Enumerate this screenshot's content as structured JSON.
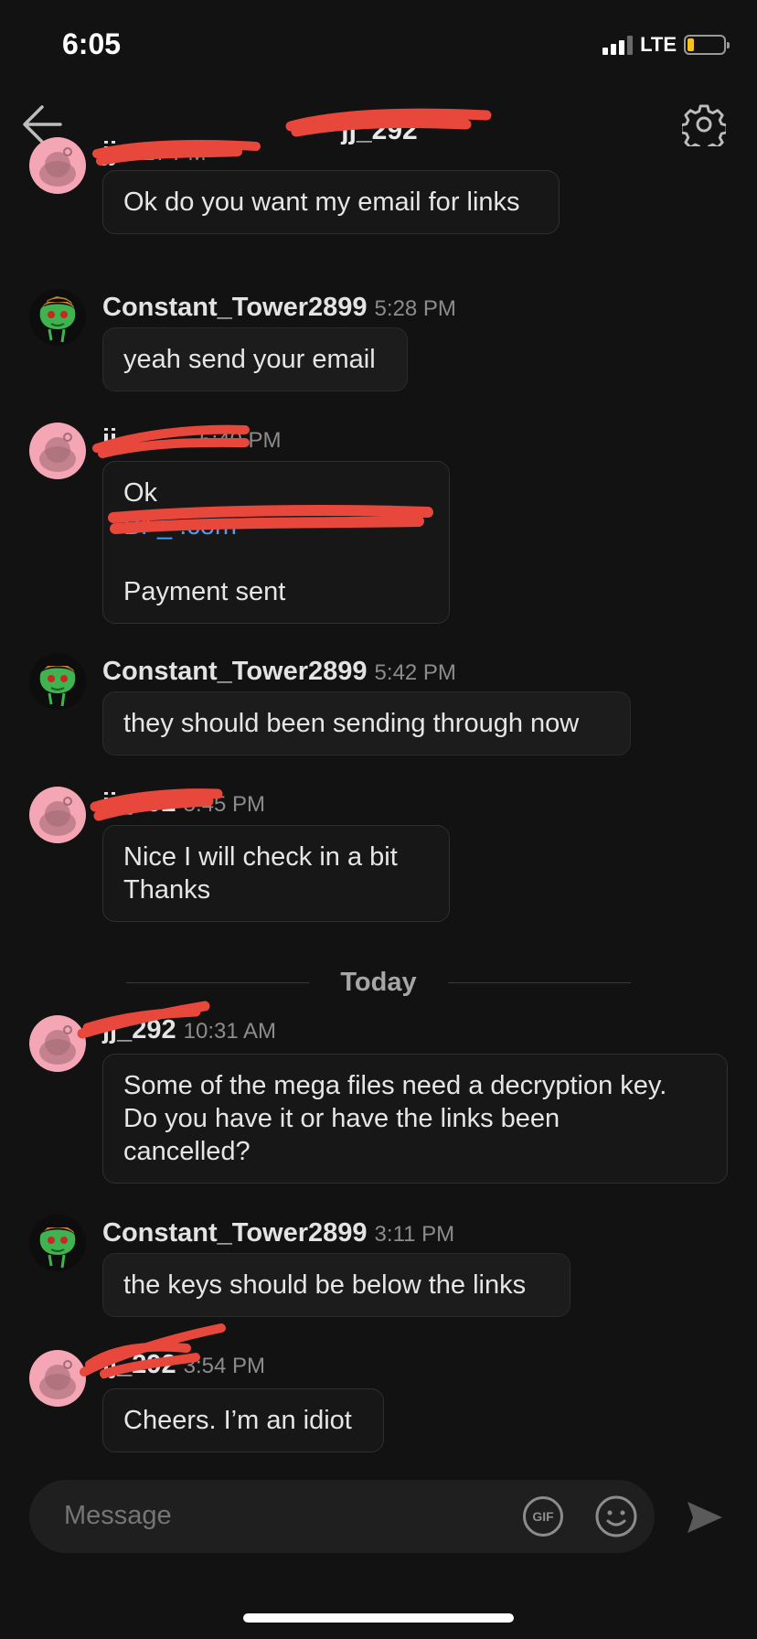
{
  "status_bar": {
    "time": "6:05",
    "network": "LTE",
    "battery_level": 0.18
  },
  "header": {
    "title": "jj_292",
    "back_icon": "back-arrow-icon",
    "settings_icon": "gear-icon"
  },
  "messages": [
    {
      "user": "jj",
      "time": "5:27 PM",
      "own": true,
      "lines": [
        "Ok do you want my email for links"
      ]
    },
    {
      "user": "Constant_Tower2899",
      "time": "5:28 PM",
      "own": false,
      "lines": [
        "yeah send your email"
      ]
    },
    {
      "user": "jj",
      "time": "5:40 PM",
      "own": true,
      "lines": [
        "Ok",
        "",
        "",
        "Payment sent"
      ],
      "link_line": "Br   _        .com"
    },
    {
      "user": "Constant_Tower2899",
      "time": "5:42 PM",
      "own": false,
      "lines": [
        "they should been sending through now"
      ]
    },
    {
      "user": "jj_292",
      "time": "5:45 PM",
      "own": true,
      "lines": [
        "Nice I will check in a  bit",
        "Thanks"
      ]
    },
    {
      "user": "jj_292",
      "time": "10:31 AM",
      "own": true,
      "lines": [
        "Some of the mega files need a decryption key.",
        "Do you have it or have the links been",
        "cancelled?"
      ]
    },
    {
      "user": "Constant_Tower2899",
      "time": "3:11 PM",
      "own": false,
      "lines": [
        "the keys should be below the links"
      ]
    },
    {
      "user": "jj_292",
      "time": "3:54 PM",
      "own": true,
      "lines": [
        "Cheers. I’m an idiot"
      ]
    }
  ],
  "divider": {
    "label": "Today"
  },
  "composer": {
    "placeholder": "Message",
    "gif_label": "GIF",
    "emoji_icon": "smiley-icon",
    "send_icon": "send-arrow-icon"
  },
  "colors": {
    "background": "#121212",
    "bubble": "#1c1c1c",
    "link": "#4a9ff5",
    "redaction": "#e8473b",
    "snoo_avatar": "#f4a6b4"
  }
}
